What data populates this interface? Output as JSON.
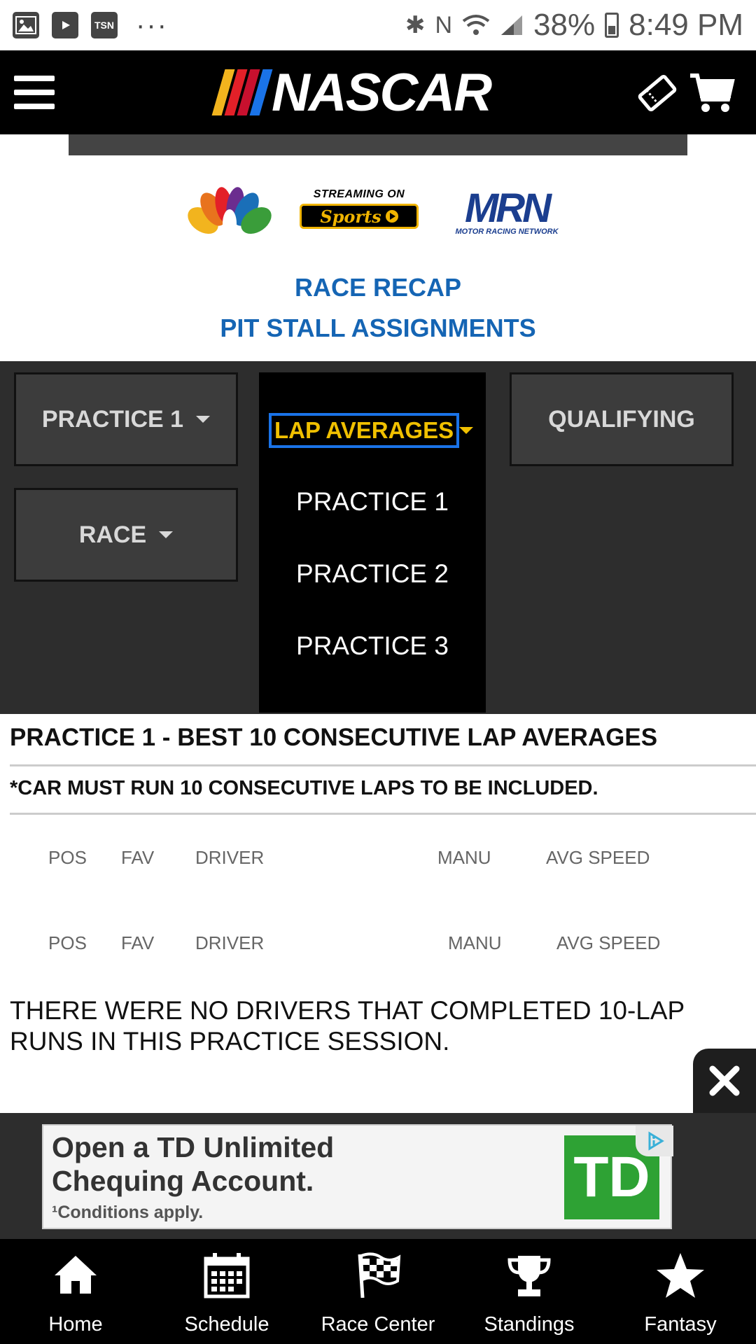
{
  "status_bar": {
    "left_icons": [
      "gallery-icon",
      "youtube-icon",
      "tsn-icon"
    ],
    "tsn_label": "TSN",
    "overflow": "···",
    "battery": "38%",
    "time": "8:49 PM"
  },
  "header": {
    "logo_text": "NASCAR",
    "stripe_colors": [
      "#f2b41e",
      "#e32028",
      "#c8102e",
      "#1a73e8"
    ]
  },
  "broadcasters": {
    "streaming_label": "STREAMING ON",
    "sports_label": "Sports",
    "mrn_label": "MRN",
    "mrn_sub": "MOTOR RACING NETWORK"
  },
  "links": {
    "race_recap": "RACE RECAP",
    "pit_stall": "PIT STALL ASSIGNMENTS"
  },
  "tabs": {
    "practice1": "PRACTICE 1",
    "lap_averages": "LAP AVERAGES",
    "qualifying": "QUALIFYING",
    "race": "RACE",
    "dropdown_items": [
      "PRACTICE 1",
      "PRACTICE 2",
      "PRACTICE 3"
    ]
  },
  "results": {
    "title": "PRACTICE 1 - BEST 10 CONSECUTIVE LAP AVERAGES",
    "note": "*CAR MUST RUN 10 CONSECUTIVE LAPS TO BE INCLUDED.",
    "columns": [
      "POS",
      "FAV",
      "DRIVER",
      "MANU",
      "AVG SPEED"
    ],
    "no_data": "THERE WERE NO DRIVERS THAT COMPLETED 10-LAP RUNS IN THIS PRACTICE SESSION."
  },
  "ad": {
    "line1": "Open a TD Unlimited",
    "line2": "Chequing Account.",
    "line3": "¹Conditions apply.",
    "brand": "TD"
  },
  "bottom_nav": {
    "items": [
      "Home",
      "Schedule",
      "Race Center",
      "Standings",
      "Fantasy"
    ]
  },
  "colors": {
    "accent_link": "#1565b4",
    "dropdown_highlight": "#f0c000",
    "focus_border": "#1a73e8",
    "td_green": "#2ea234"
  }
}
